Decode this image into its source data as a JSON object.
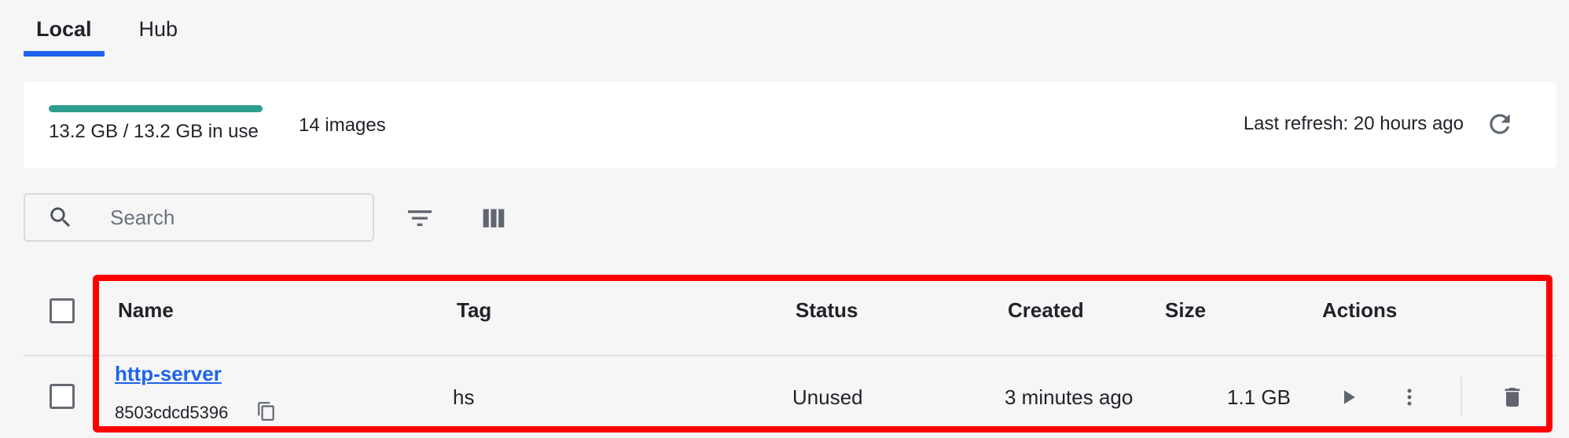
{
  "tabs": [
    {
      "label": "Local",
      "active": true
    },
    {
      "label": "Hub",
      "active": false
    }
  ],
  "summary": {
    "usage_text": "13.2 GB / 13.2 GB in use",
    "usage_fraction": 1.0,
    "images_count": "14 images",
    "last_refresh": "Last refresh: 20 hours ago"
  },
  "search": {
    "placeholder": "Search",
    "value": ""
  },
  "table": {
    "columns": {
      "name": "Name",
      "tag": "Tag",
      "status": "Status",
      "created": "Created",
      "size": "Size",
      "actions": "Actions"
    },
    "rows": [
      {
        "name": "http-server",
        "id": "8503cdcd5396",
        "tag": "hs",
        "status": "Unused",
        "created": "3 minutes ago",
        "size": "1.1 GB"
      }
    ]
  },
  "icons": {
    "refresh": "refresh-icon",
    "search": "search-icon",
    "filter": "filter-icon",
    "columns": "columns-icon",
    "copy": "copy-icon",
    "run": "play-icon",
    "more": "more-vertical-icon",
    "delete": "trash-icon"
  },
  "colors": {
    "accent": "#1d63ed",
    "usage_bar": "#2f9e8e",
    "highlight": "#ff0000",
    "icon": "#5f6670"
  }
}
